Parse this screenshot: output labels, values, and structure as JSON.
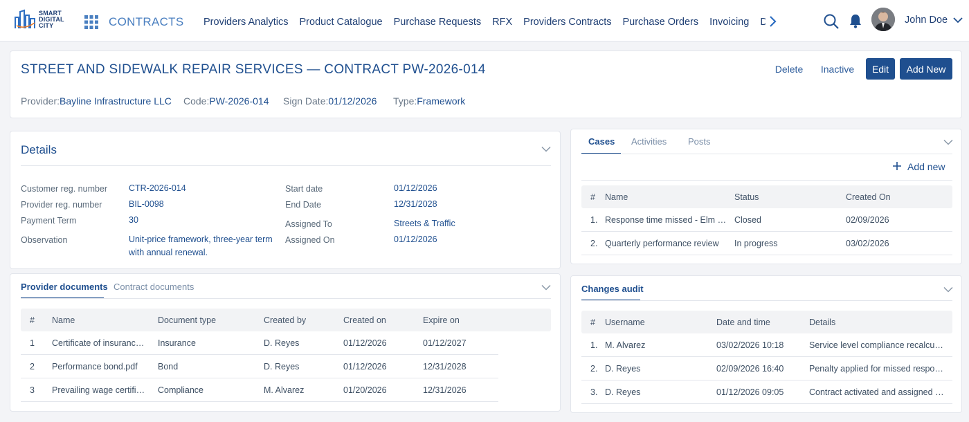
{
  "brand": {
    "line1": "SMART",
    "line2": "DIGITAL",
    "line3": "CITY",
    "app_name": "CONTRACTS"
  },
  "nav": [
    "Providers Analytics",
    "Product Catalogue",
    "Purchase Requests",
    "RFX",
    "Providers Contracts",
    "Purchase Orders",
    "Invoicing",
    "De"
  ],
  "user": {
    "name": "John Doe"
  },
  "header": {
    "title": "STREET AND SIDEWALK REPAIR SERVICES — CONTRACT PW-2026-014",
    "buttons": {
      "delete": "Delete",
      "inactive": "Inactive",
      "edit": "Edit",
      "add_new": "Add New"
    },
    "meta": {
      "provider_label": "Provider:",
      "provider": "Bayline Infrastructure LLC",
      "code_label": "Code:",
      "code": "PW-2026-014",
      "sign_label": "Sign Date:",
      "sign_date": "01/12/2026",
      "type_label": "Type:",
      "type": "Framework"
    }
  },
  "details": {
    "title": "Details",
    "customer_reg_label": "Customer reg. number",
    "customer_reg": "CTR-2026-014",
    "provider_reg_label": "Provider reg. number",
    "provider_reg": "BIL-0098",
    "payment_term_label": "Payment Term",
    "payment_term": "30",
    "observation_label": "Observation",
    "observation_line1": "Unit-price framework, three-year term",
    "observation_line2": "with annual renewal.",
    "start_label": "Start date",
    "start": "01/12/2026",
    "end_label": "End Date",
    "end": "12/31/2028",
    "assigned_to_label": "Assigned To",
    "assigned_to": "Streets & Traffic",
    "assigned_on_label": "Assigned On",
    "assigned_on": "01/12/2026"
  },
  "documents": {
    "tabs": [
      "Provider documents",
      "Contract documents"
    ],
    "headers": [
      "#",
      "Name",
      "Document type",
      "Created by",
      "Created on",
      "Expire on"
    ],
    "rows": [
      [
        "1",
        "Certificate of insurance.pdf",
        "Insurance",
        "D. Reyes",
        "01/12/2026",
        "01/12/2027"
      ],
      [
        "2",
        "Performance bond.pdf",
        "Bond",
        "D. Reyes",
        "01/12/2026",
        "12/31/2028"
      ],
      [
        "3",
        "Prevailing wage certificate.pdf",
        "Compliance",
        "M. Alvarez",
        "01/20/2026",
        "12/31/2026"
      ]
    ]
  },
  "cases": {
    "tabs": [
      "Cases",
      "Activities",
      "Posts"
    ],
    "add_new": "Add new",
    "headers": [
      "#",
      "Name",
      "Status",
      "Created On"
    ],
    "rows": [
      [
        "1.",
        "Response time missed - Elm Street",
        "Closed",
        "02/09/2026"
      ],
      [
        "2.",
        "Quarterly performance review",
        "In progress",
        "03/02/2026"
      ]
    ]
  },
  "audit": {
    "title": "Changes audit",
    "headers": [
      "#",
      "Username",
      "Date and time",
      "Details"
    ],
    "rows": [
      [
        "1.",
        "M. Alvarez",
        "03/02/2026 10:18",
        "Service level compliance recalculated"
      ],
      [
        "2.",
        "D. Reyes",
        "02/09/2026 16:40",
        "Penalty applied for missed response"
      ],
      [
        "3.",
        "D. Reyes",
        "01/12/2026 09:05",
        "Contract activated and assigned to Streets & Traffic"
      ]
    ]
  }
}
